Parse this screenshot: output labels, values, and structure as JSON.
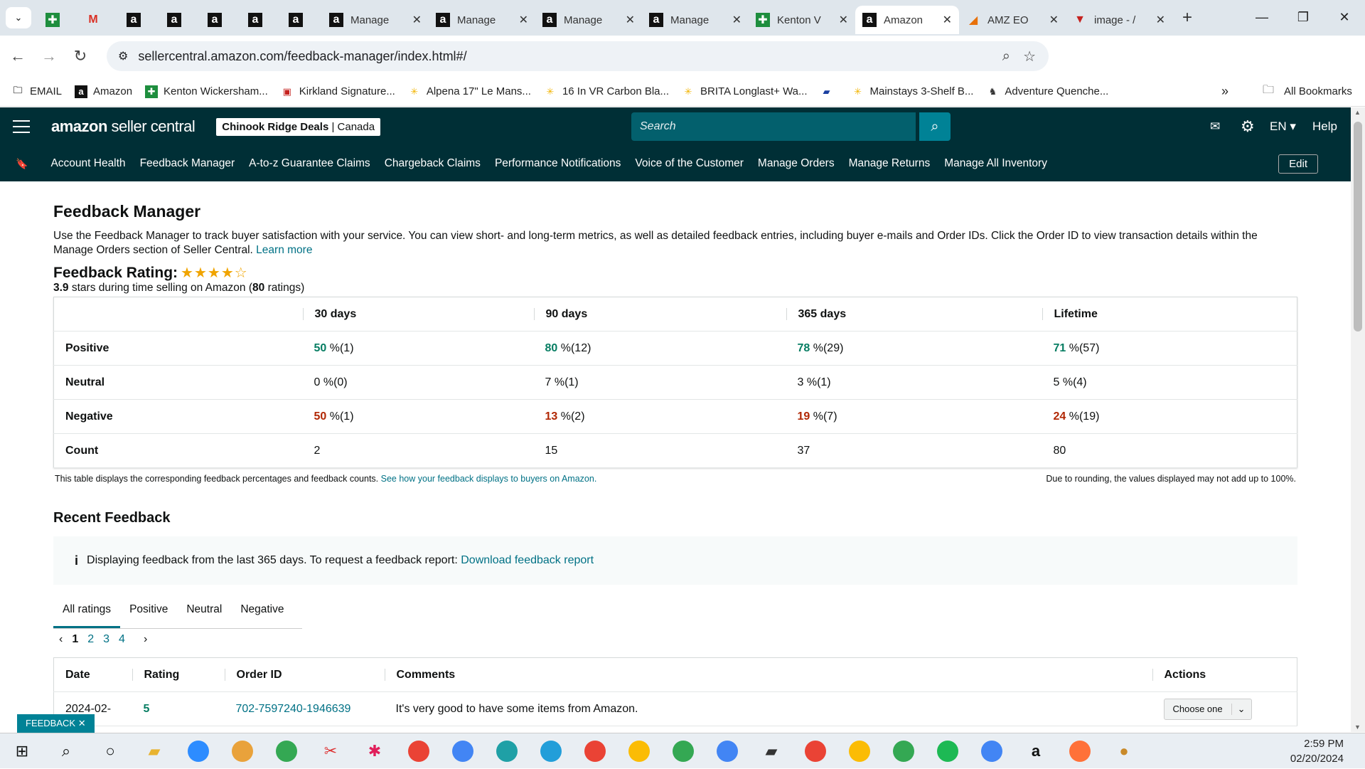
{
  "browser": {
    "tabs": [
      {
        "icon": "sheets-icon",
        "label": "",
        "active": false
      },
      {
        "icon": "gmail-icon",
        "label": "",
        "active": false
      },
      {
        "icon": "amazon-icon",
        "label": "",
        "active": false
      },
      {
        "icon": "amazon-icon",
        "label": "",
        "active": false
      },
      {
        "icon": "amazon-icon",
        "label": "",
        "active": false
      },
      {
        "icon": "amazon-icon",
        "label": "",
        "active": false
      },
      {
        "icon": "amazon-icon",
        "label": "",
        "active": false
      },
      {
        "icon": "amazon-icon",
        "label": "Manage",
        "active": false
      },
      {
        "icon": "amazon-icon",
        "label": "Manage",
        "active": false
      },
      {
        "icon": "amazon-icon",
        "label": "Manage",
        "active": false
      },
      {
        "icon": "amazon-icon",
        "label": "Manage",
        "active": false
      },
      {
        "icon": "sheets-icon",
        "label": "Kenton V",
        "active": false
      },
      {
        "icon": "amazon-icon",
        "label": "Amazon",
        "active": true
      },
      {
        "icon": "amz-icon",
        "label": "AMZ EO",
        "active": false
      },
      {
        "icon": "image-icon",
        "label": "image - /",
        "active": false
      }
    ],
    "url": "sellercentral.amazon.com/feedback-manager/index.html#/",
    "bookmarks": [
      "EMAIL",
      "Amazon",
      "Kenton Wickersham...",
      "Kirkland Signature...",
      "Alpena 17\" Le Mans...",
      "16 In VR Carbon Bla...",
      "BRITA Longlast+ Wa...",
      "",
      "Mainstays 3-Shelf B...",
      "Adventure Quenche..."
    ],
    "all_bookmarks": "All Bookmarks"
  },
  "header": {
    "logo_main": "amazon",
    "logo_sub": "seller central",
    "store_name": "Chinook Ridge Deals",
    "store_region": "Canada",
    "search_placeholder": "Search",
    "language": "EN",
    "help": "Help"
  },
  "nav": {
    "items": [
      "Account Health",
      "Feedback Manager",
      "A-to-z Guarantee Claims",
      "Chargeback Claims",
      "Performance Notifications",
      "Voice of the Customer",
      "Manage Orders",
      "Manage Returns",
      "Manage All Inventory"
    ],
    "edit": "Edit"
  },
  "page": {
    "title": "Feedback Manager",
    "description": "Use the Feedback Manager to track buyer satisfaction with your service. You can view short- and long-term metrics, as well as detailed feedback entries, including buyer e-mails and Order IDs. Click the Order ID to view transaction details within the Manage Orders section of Seller Central.",
    "learn_more": "Learn more",
    "rating_label": "Feedback Rating:",
    "rating_value": "3.9",
    "rating_text_pre": " stars during time selling on Amazon (",
    "rating_count": "80",
    "rating_text_post": " ratings)",
    "stars": 3.9
  },
  "summary_table": {
    "headers": [
      "",
      "30 days",
      "90 days",
      "365 days",
      "Lifetime"
    ],
    "rows": [
      {
        "label": "Positive",
        "cells": [
          [
            "50",
            " %(1)"
          ],
          [
            "80",
            " %(12)"
          ],
          [
            "78",
            " %(29)"
          ],
          [
            "71",
            " %(57)"
          ]
        ],
        "color": "g"
      },
      {
        "label": "Neutral",
        "cells": [
          [
            "0",
            " %(0)"
          ],
          [
            "7",
            " %(1)"
          ],
          [
            "3",
            " %(1)"
          ],
          [
            "5",
            " %(4)"
          ]
        ],
        "color": ""
      },
      {
        "label": "Negative",
        "cells": [
          [
            "50",
            " %(1)"
          ],
          [
            "13",
            " %(2)"
          ],
          [
            "19",
            " %(7)"
          ],
          [
            "24",
            " %(19)"
          ]
        ],
        "color": "r"
      },
      {
        "label": "Count",
        "cells": [
          [
            "",
            "2"
          ],
          [
            "",
            "15"
          ],
          [
            "",
            "37"
          ],
          [
            "",
            "80"
          ]
        ],
        "color": ""
      }
    ],
    "note_left": "This table displays the corresponding feedback percentages and feedback counts.",
    "note_link": "See how your feedback displays to buyers on Amazon.",
    "note_right": "Due to rounding, the values displayed may not add up to 100%."
  },
  "recent": {
    "title": "Recent Feedback",
    "info_text": "Displaying feedback from the last 365 days. To request a feedback report:",
    "info_link": "Download feedback report",
    "tabs": [
      "All ratings",
      "Positive",
      "Neutral",
      "Negative"
    ],
    "pages": [
      "1",
      "2",
      "3",
      "4"
    ],
    "columns": [
      "Date",
      "Rating",
      "Order ID",
      "Comments",
      "Actions"
    ],
    "rows": [
      {
        "date": "2024-02-",
        "rating": "5",
        "order_id": "702-7597240-1946639",
        "comment": "It's very good to have some items from Amazon.",
        "action": "Choose one"
      }
    ]
  },
  "feedback_tag": "FEEDBACK",
  "clock": {
    "time": "2:59 PM",
    "date": "02/20/2024"
  }
}
